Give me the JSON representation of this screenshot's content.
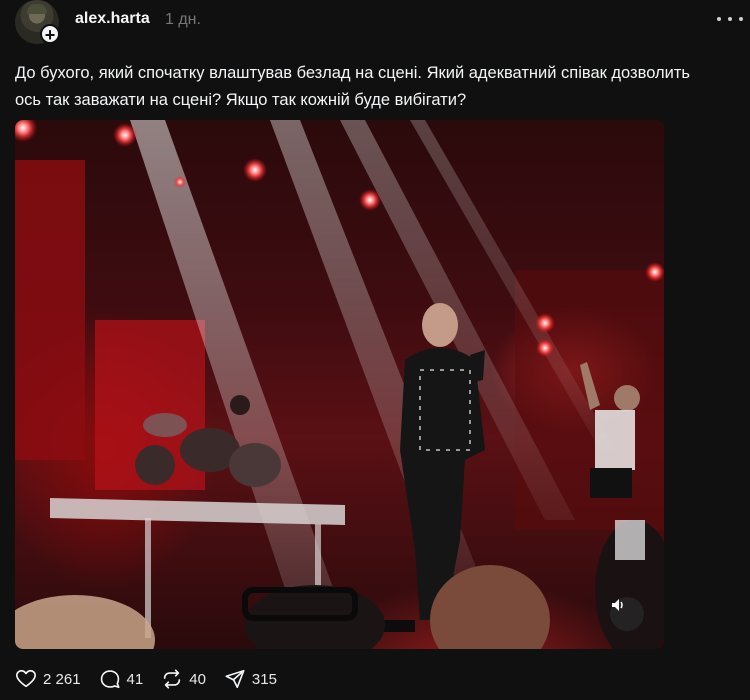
{
  "post": {
    "username": "alex.harta",
    "time": "1 дн.",
    "caption": "До бухого, який спочатку влаштував безлад на сцені. Який адекватний співак дозволить ось так заважати на сцені? Якщо так кожній буде вибігати?"
  },
  "avatar": {
    "badge_symbol": "+"
  },
  "actions": {
    "likes": "2 261",
    "comments": "41",
    "reposts": "40",
    "shares": "315"
  },
  "icons": {
    "like": "heart-icon",
    "comment": "comment-bubble-icon",
    "repost": "repost-icon",
    "share": "send-icon",
    "more": "more-horizontal-icon",
    "sound": "speaker-icon",
    "follow": "plus-icon"
  },
  "colors": {
    "background": "#101010",
    "text": "#f3f5f7",
    "muted": "#777777",
    "stage_red": "#c4121c"
  }
}
